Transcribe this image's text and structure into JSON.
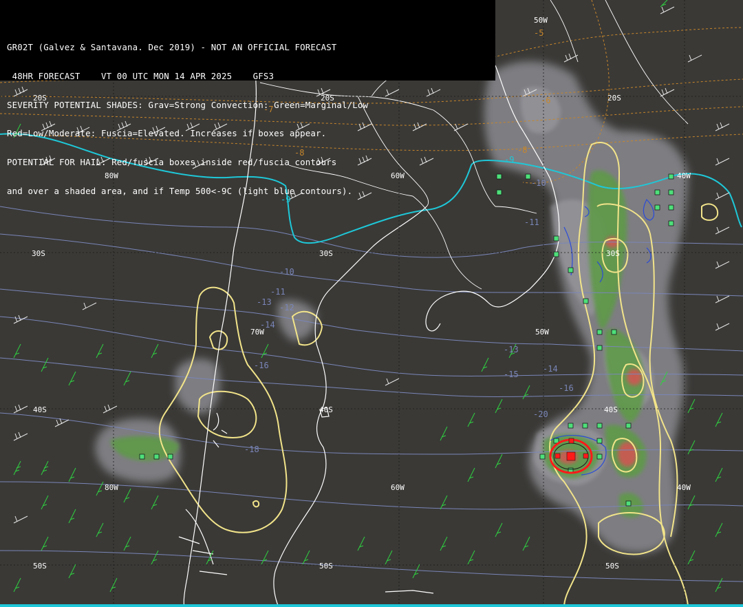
{
  "header": {
    "line1": "GR02T (Galvez & Santavana. Dec 2019) - NOT AN OFFICIAL FORECAST",
    "line2": " 48HR FORECAST    VT 00 UTC MON 14 APR 2025    GFS3",
    "line3": "SEVERITY POTENTIAL SHADES: Grav=Strong Convection: Green=Marginal/Low",
    "line4": "Red=Low/Moderate: Fuscia=Elevated. Increases if boxes appear.",
    "line5": "POTENTIAL FOR HAIL: Red/fuscia boxes inside red/fuscia contours",
    "line6": "and over a shaded area, and if Temp 500<-9C (light blue contours)."
  },
  "grid_labels": {
    "lon_50w_top": "50W",
    "lat_20s_1": "20S",
    "lat_20s_2": "20S",
    "lat_20s_3": "20S",
    "lon_80w_top": "80W",
    "lon_60w_top": "60W",
    "lon_40w_top": "40W",
    "lat_30s_1": "30S",
    "lat_30s_2": "30S",
    "lat_30s_3": "30S",
    "lon_70w": "70W",
    "lon_50w_mid": "50W",
    "lat_40s_1": "40S",
    "lat_40s_2": "40S",
    "lat_40s_3": "40S",
    "lon_80w_bot": "80W",
    "lon_60w_bot": "60W",
    "lon_40w_bot": "40W",
    "lat_50s_1": "50S",
    "lat_50s_2": "50S",
    "lat_50s_3": "50S"
  },
  "temp_labels": {
    "t_m5": "-5",
    "t_m6": "-6",
    "t_m7": "-7",
    "t_m8a": "-8",
    "t_m8b": "-8",
    "t_m9a": "-9",
    "t_m9b": "-9",
    "t_m10a": "-10",
    "t_m10b": "-10",
    "t_m11a": "-11",
    "t_m11b": "-11",
    "t_m12": "-12",
    "t_m13a": "-13",
    "t_m13b": "-13",
    "t_m14a": "-14",
    "t_m14b": "-14",
    "t_m15": "-15",
    "t_m16a": "-16",
    "t_m16b": "-16",
    "t_m18": "-18",
    "t_m20": "-20"
  },
  "colors": {
    "background": "#3a3936",
    "coastline": "#ffffff",
    "contour_minus9": "#1ec8d8",
    "temp_contours": "#7a86b8",
    "warm_contours": "#c8862a",
    "yellow_contours": "#f2e48a",
    "gray_shade": "#8a8a90",
    "green_shade": "#5f9a48",
    "red_shade": "#c95a52",
    "box_green": "#4ee07a",
    "box_red": "#ff1a1a",
    "wind_green": "#2fd040",
    "wind_white": "#e8e8e8"
  }
}
